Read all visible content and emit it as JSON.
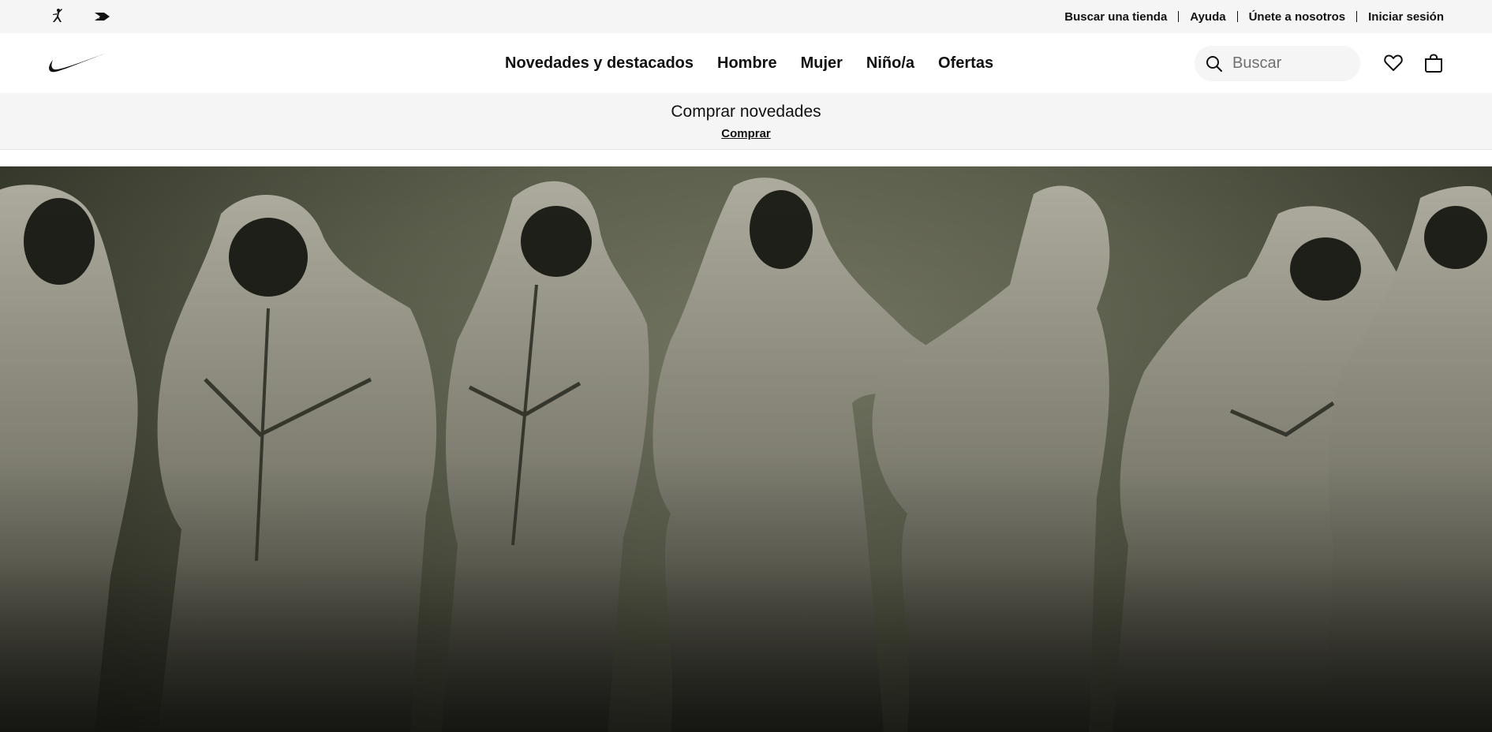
{
  "utility_bar": {
    "brand_icons": [
      "jordan-jumpman-icon",
      "converse-icon"
    ],
    "links": [
      "Buscar una tienda",
      "Ayuda",
      "Únete a nosotros",
      "Iniciar sesión"
    ]
  },
  "header": {
    "logo": "nike-swoosh-icon",
    "nav": [
      "Novedades y destacados",
      "Hombre",
      "Mujer",
      "Niño/a",
      "Ofertas"
    ],
    "search": {
      "placeholder": "Buscar",
      "value": "",
      "icon": "search-icon"
    },
    "favorites_icon": "heart-icon",
    "bag_icon": "bag-icon"
  },
  "promo": {
    "title": "Comprar novedades",
    "link": "Comprar"
  },
  "hero": {
    "image": "models-in-grey-hooded-tracksuits",
    "colors": {
      "background": "#5d604d",
      "garment": "#a9a899",
      "shadow": "#2b2c23"
    }
  }
}
